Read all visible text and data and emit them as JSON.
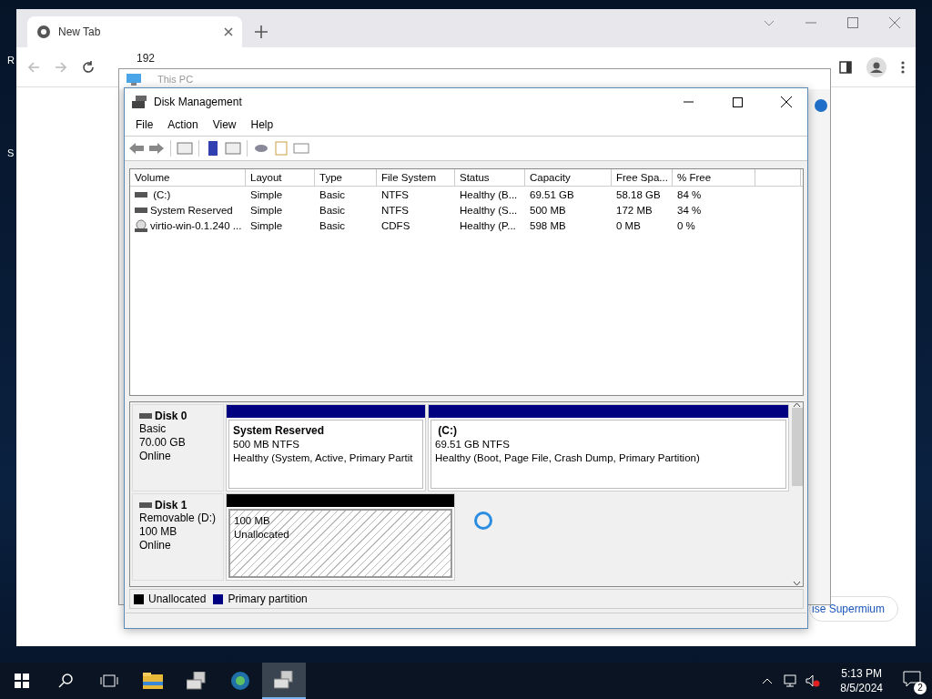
{
  "desktop": {
    "icon_labels": [
      "R",
      "S"
    ]
  },
  "browser": {
    "tab": {
      "title": "New Tab"
    },
    "address": "192",
    "page_button": "ise Supermium"
  },
  "explorer": {
    "title": "This PC"
  },
  "disk_management": {
    "title": "Disk Management",
    "menu": [
      "File",
      "Action",
      "View",
      "Help"
    ],
    "table": {
      "columns": [
        "Volume",
        "Layout",
        "Type",
        "File System",
        "Status",
        "Capacity",
        "Free Spa...",
        "% Free"
      ],
      "rows": [
        {
          "kind": "disk",
          "cells": [
            " (C:)",
            "Simple",
            "Basic",
            "NTFS",
            "Healthy (B...",
            "69.51 GB",
            "58.18 GB",
            "84 %"
          ]
        },
        {
          "kind": "disk",
          "cells": [
            "System Reserved",
            "Simple",
            "Basic",
            "NTFS",
            "Healthy (S...",
            "500 MB",
            "172 MB",
            "34 %"
          ]
        },
        {
          "kind": "cd",
          "cells": [
            "virtio-win-0.1.240 ...",
            "Simple",
            "Basic",
            "CDFS",
            "Healthy (P...",
            "598 MB",
            "0 MB",
            "0 %"
          ]
        }
      ]
    },
    "disks": [
      {
        "name": "Disk 0",
        "details": [
          "Basic",
          "70.00 GB",
          "Online"
        ],
        "partitions": [
          {
            "kind": "primary",
            "name": "System Reserved",
            "size": "500 MB NTFS",
            "status": "Healthy (System, Active, Primary Partit"
          },
          {
            "kind": "primary",
            "name": " (C:)",
            "size": "69.51 GB NTFS",
            "status": "Healthy (Boot, Page File, Crash Dump, Primary Partition)"
          }
        ]
      },
      {
        "name": "Disk 1",
        "details": [
          "Removable (D:)",
          "100 MB",
          "Online"
        ],
        "partitions": [
          {
            "kind": "unallocated",
            "size": "100 MB",
            "status": "Unallocated"
          }
        ]
      }
    ],
    "legend": [
      {
        "label": "Unallocated",
        "color": "#000000"
      },
      {
        "label": "Primary partition",
        "color": "#000080"
      }
    ]
  },
  "taskbar": {
    "apps": [
      {
        "kind": "folder",
        "selected": false
      },
      {
        "kind": "disk",
        "selected": false
      },
      {
        "kind": "globe",
        "selected": false
      },
      {
        "kind": "disk",
        "selected": true
      }
    ],
    "time": "5:13 PM",
    "date": "8/5/2024",
    "notifications": "2"
  }
}
